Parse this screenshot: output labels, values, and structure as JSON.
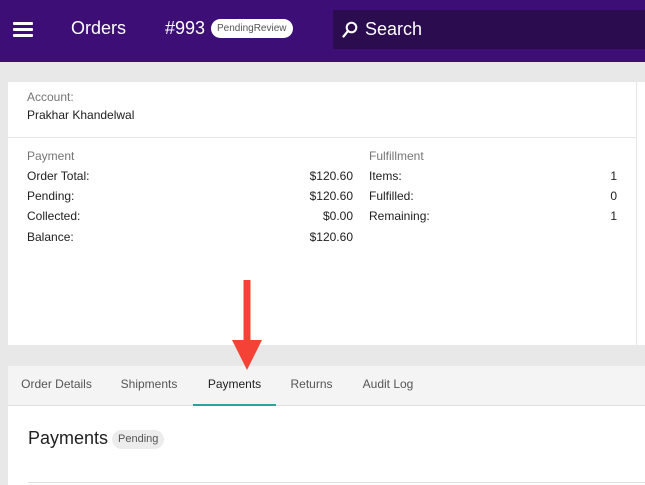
{
  "topbar": {
    "title": "Orders",
    "order_number": "#993",
    "status_badge": "PendingReview",
    "search_placeholder": "Search",
    "color": "#3d0e75"
  },
  "account": {
    "label": "Account:",
    "name": "Prakhar Khandelwal"
  },
  "payment": {
    "heading": "Payment",
    "rows": [
      {
        "label": "Order Total:",
        "value": "$120.60"
      },
      {
        "label": "Pending:",
        "value": "$120.60"
      },
      {
        "label": "Collected:",
        "value": "$0.00"
      },
      {
        "label": "Balance:",
        "value": "$120.60"
      }
    ]
  },
  "fulfillment": {
    "heading": "Fulfillment",
    "rows": [
      {
        "label": "Items:",
        "value": "1"
      },
      {
        "label": "Fulfilled:",
        "value": "0"
      },
      {
        "label": "Remaining:",
        "value": "1"
      }
    ]
  },
  "tabs": {
    "items": [
      "Order Details",
      "Shipments",
      "Payments",
      "Returns",
      "Audit Log"
    ],
    "active": "Payments",
    "accent_color": "#26a69a"
  },
  "payments_section": {
    "title": "Payments",
    "badge": "Pending"
  },
  "annotation": {
    "arrow_color": "#f44336"
  }
}
